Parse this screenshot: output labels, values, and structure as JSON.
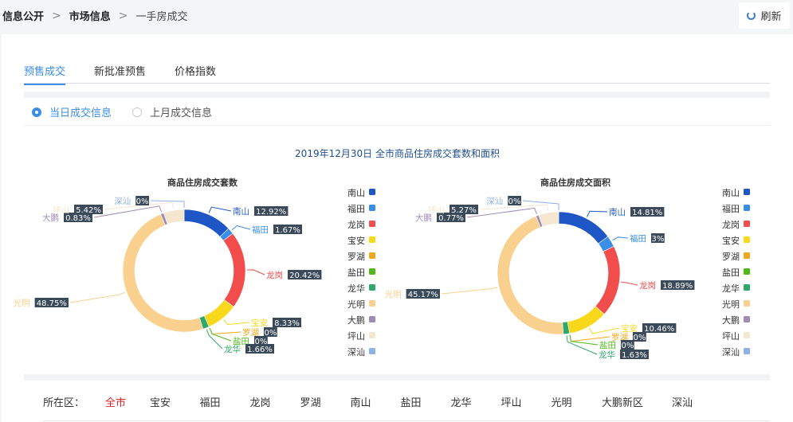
{
  "breadcrumb": {
    "level1": "信息公开",
    "level2": "市场信息",
    "level3": "一手房成交",
    "separator": ">"
  },
  "refresh_label": "刷新",
  "tabs": [
    {
      "label": "预售成交",
      "active": true
    },
    {
      "label": "新批准预售",
      "active": false
    },
    {
      "label": "价格指数",
      "active": false
    }
  ],
  "radios": [
    {
      "label": "当日成交信息",
      "checked": true
    },
    {
      "label": "上月成交信息",
      "checked": false
    }
  ],
  "main_title": "2019年12月30日 全市商品住房成交套数和面积",
  "filter": {
    "label": "所在区：",
    "selected": "全市",
    "options": [
      "全市",
      "宝安",
      "福田",
      "龙岗",
      "罗湖",
      "南山",
      "盐田",
      "龙华",
      "坪山",
      "光明",
      "大鹏新区",
      "深汕"
    ]
  },
  "colors": {
    "南山": "#1f56c6",
    "福田": "#3a8ee6",
    "龙岗": "#f24d4d",
    "宝安": "#f7d81b",
    "罗湖": "#f0a81b",
    "盐田": "#4fb81a",
    "龙华": "#2fa86a",
    "光明": "#f9d08e",
    "大鹏": "#a08ab6",
    "坪山": "#f5e6d0",
    "深汕": "#8db0e6"
  },
  "chart_data": [
    {
      "type": "pie",
      "title": "商品住房成交套数",
      "categories": [
        "南山",
        "福田",
        "龙岗",
        "宝安",
        "罗湖",
        "盐田",
        "龙华",
        "光明",
        "大鹏",
        "坪山",
        "深汕"
      ],
      "values": [
        12.92,
        1.67,
        20.42,
        8.33,
        0,
        0,
        1.66,
        48.75,
        0.83,
        5.42,
        0
      ],
      "value_labels": [
        "12.92%",
        "1.67%",
        "20.42%",
        "8.33%",
        "0%",
        "0%",
        "1.66%",
        "48.75%",
        "0.83%",
        "5.42%",
        "0%"
      ],
      "legend": {
        "position": "right",
        "entries": [
          "南山",
          "福田",
          "龙岗",
          "宝安",
          "罗湖",
          "盐田",
          "龙华",
          "光明",
          "大鹏",
          "坪山",
          "深汕"
        ]
      }
    },
    {
      "type": "pie",
      "title": "商品住房成交面积",
      "categories": [
        "南山",
        "福田",
        "龙岗",
        "宝安",
        "罗湖",
        "盐田",
        "龙华",
        "光明",
        "大鹏",
        "坪山",
        "深汕"
      ],
      "values": [
        14.81,
        3,
        18.89,
        10.46,
        0,
        0,
        1.63,
        45.17,
        0.77,
        5.27,
        0
      ],
      "value_labels": [
        "14.81%",
        "3%",
        "18.89%",
        "10.46%",
        "0%",
        "0%",
        "1.63%",
        "45.17%",
        "0.77%",
        "5.27%",
        "0%"
      ],
      "legend": {
        "position": "right",
        "entries": [
          "南山",
          "福田",
          "龙岗",
          "宝安",
          "罗湖",
          "盐田",
          "龙华",
          "光明",
          "大鹏",
          "坪山",
          "深汕"
        ]
      }
    }
  ]
}
